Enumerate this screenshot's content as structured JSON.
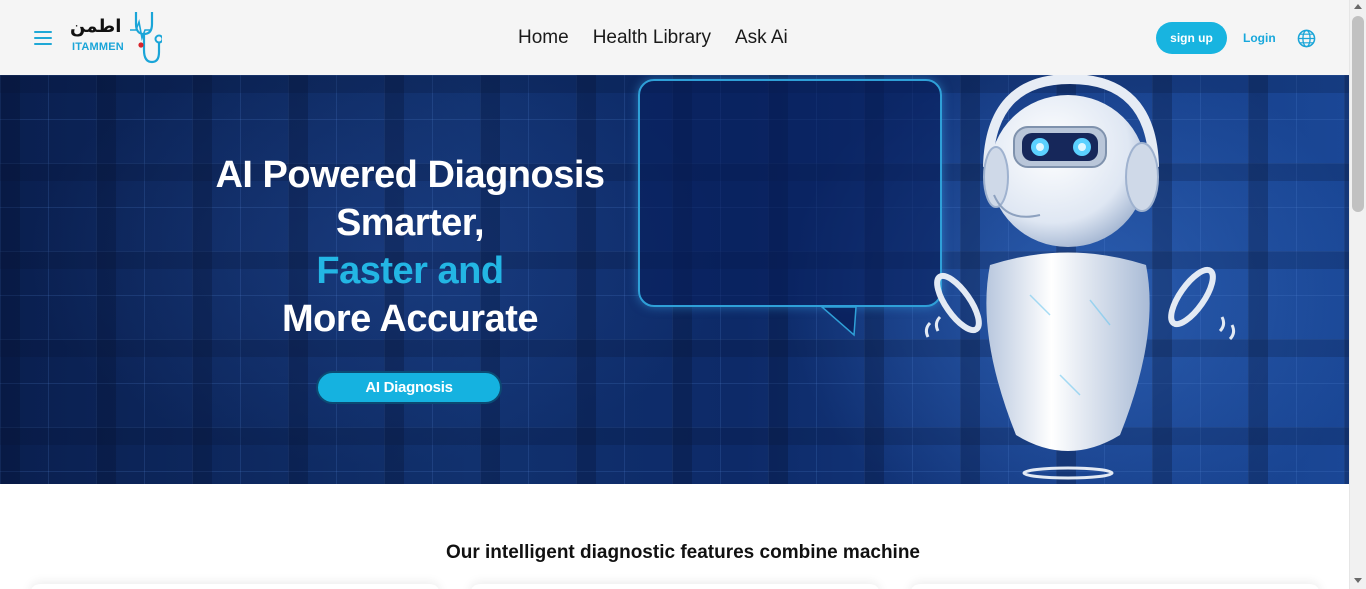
{
  "header": {
    "logo": {
      "arabic": "اطمن",
      "english": "ITAMMEN"
    },
    "nav": [
      {
        "label": "Home"
      },
      {
        "label": "Health Library"
      },
      {
        "label": "Ask Ai"
      }
    ],
    "signup_label": "sign up",
    "login_label": "Login",
    "icons": {
      "menu": "hamburger-menu-icon",
      "language": "globe-icon"
    }
  },
  "hero": {
    "line1": "AI Powered Diagnosis",
    "line2": "Smarter,",
    "line3": "Faster and",
    "line4": "More Accurate",
    "cta_label": "AI Diagnosis"
  },
  "features": {
    "heading": "Our intelligent diagnostic features combine machine"
  },
  "colors": {
    "accent": "#18b4e0",
    "hero_dark": "#0d2a68",
    "header_bg": "#f5f5f5"
  }
}
